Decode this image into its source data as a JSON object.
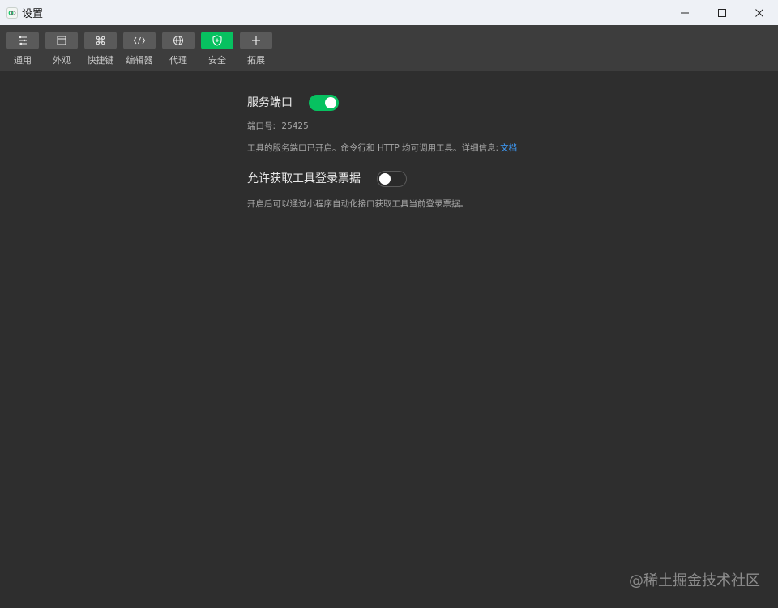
{
  "window": {
    "title": "设置",
    "controls": [
      "minimize",
      "maximize",
      "close"
    ]
  },
  "toolbar": {
    "items": [
      {
        "label": "通用",
        "icon": "sliders-icon",
        "active": false
      },
      {
        "label": "外观",
        "icon": "window-icon",
        "active": false
      },
      {
        "label": "快捷键",
        "icon": "command-key-icon",
        "active": false
      },
      {
        "label": "编辑器",
        "icon": "code-icon",
        "active": false
      },
      {
        "label": "代理",
        "icon": "globe-icon",
        "active": false
      },
      {
        "label": "安全",
        "icon": "shield-icon",
        "active": true
      },
      {
        "label": "拓展",
        "icon": "plus-icon",
        "active": false
      }
    ]
  },
  "settings": {
    "service_port": {
      "title": "服务端口",
      "enabled": true,
      "port_label": "端口号:",
      "port_value": "25425",
      "description": "工具的服务端口已开启。命令行和 HTTP 均可调用工具。详细信息:",
      "link_text": "文档"
    },
    "login_ticket": {
      "title": "允许获取工具登录票据",
      "enabled": false,
      "description": "开启后可以通过小程序自动化接口获取工具当前登录票据。"
    }
  },
  "watermark": "@稀土掘金技术社区",
  "colors": {
    "accent": "#07c160",
    "link": "#3f9fff",
    "background": "#2e2e2e",
    "toolbar": "#3d3d3d"
  }
}
